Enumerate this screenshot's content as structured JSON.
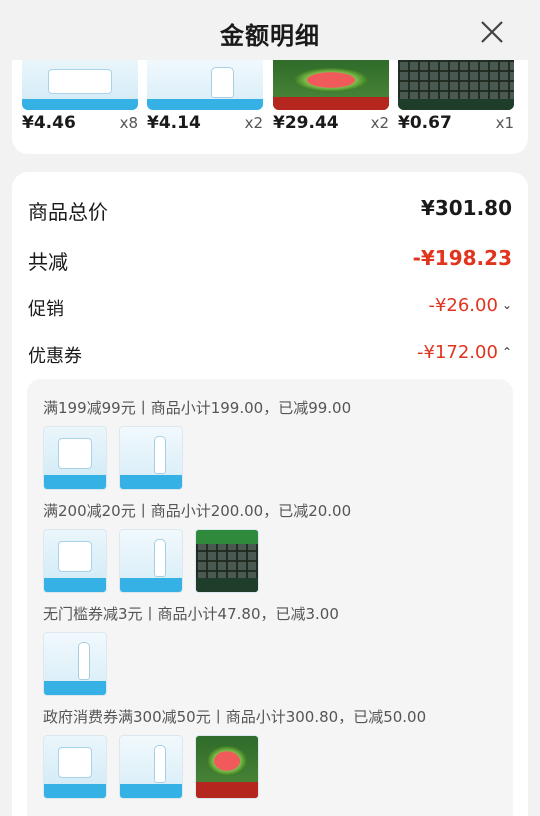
{
  "header": {
    "title": "金额明细"
  },
  "thumbs": [
    {
      "price": "¥4.46",
      "qty": "x8"
    },
    {
      "price": "¥4.14",
      "qty": "x2"
    },
    {
      "price": "¥29.44",
      "qty": "x2"
    },
    {
      "price": "¥0.67",
      "qty": "x1"
    }
  ],
  "summary": {
    "total_label": "商品总价",
    "total_value": "¥301.80",
    "discount_label": "共减",
    "discount_value": "-¥198.23",
    "promo_label": "促销",
    "promo_value": "-¥26.00",
    "coupon_label": "优惠券",
    "coupon_value": "-¥172.00"
  },
  "coupons": [
    {
      "text": "满199减99元丨商品小计199.00，已减99.00"
    },
    {
      "text": "满200减20元丨商品小计200.00，已减20.00"
    },
    {
      "text": "无门槛券减3元丨商品小计47.80，已减3.00"
    },
    {
      "text": "政府消费券满300减50元丨商品小计300.80，已减50.00"
    }
  ],
  "colors": {
    "accent_red": "#e0341f",
    "card_bg": "#ffffff",
    "page_bg": "#f2f2f2"
  },
  "icons": {
    "close": "close-icon",
    "promo_chevron": "chevron-down-icon",
    "coupon_chevron": "chevron-up-icon"
  }
}
